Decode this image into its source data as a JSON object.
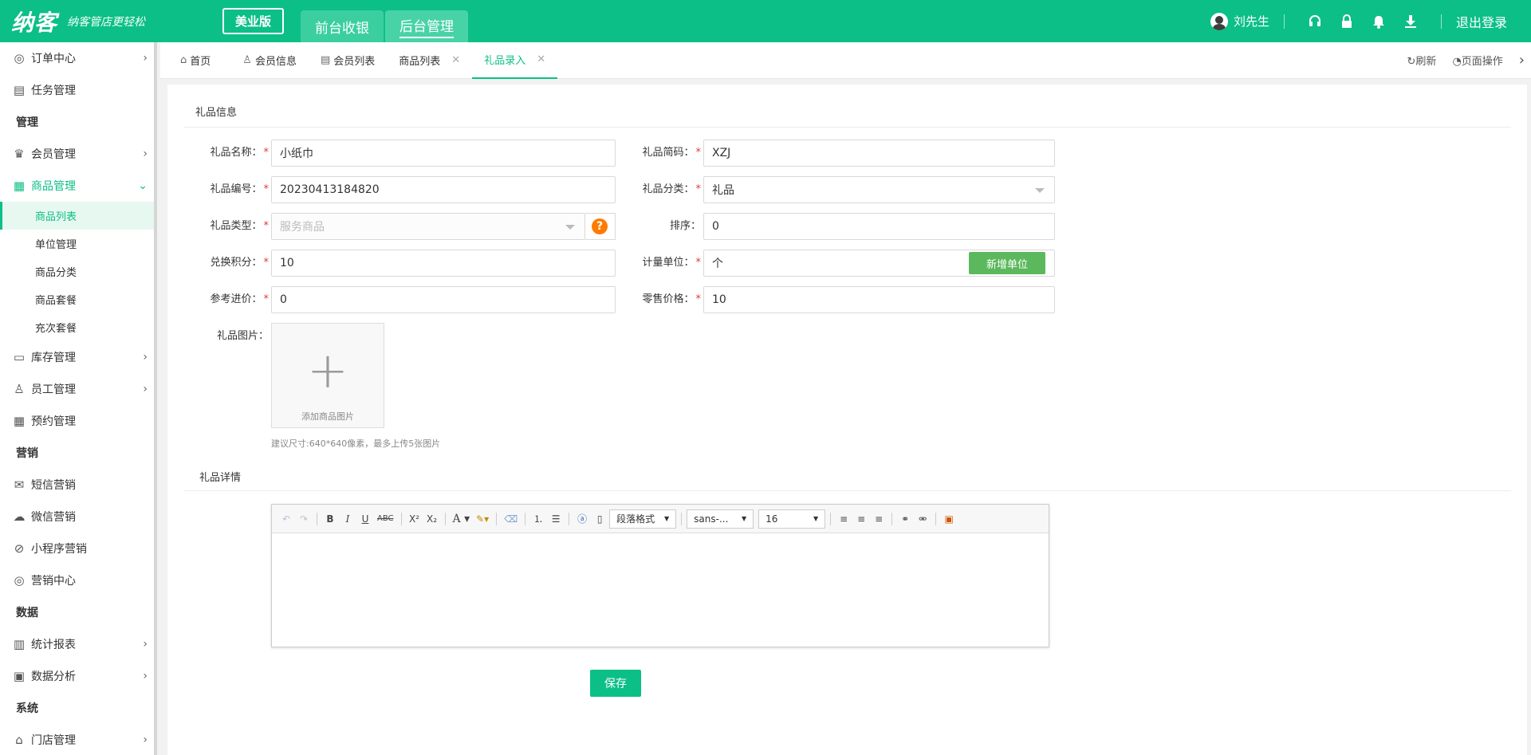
{
  "header": {
    "logo": "纳客",
    "slogan": "纳客管店更轻松",
    "edition": "美业版",
    "tabs": [
      {
        "label": "前台收银"
      },
      {
        "label": "后台管理"
      }
    ],
    "user_name": "刘先生",
    "logout": "退出登录",
    "icons": [
      "headset-icon",
      "lock-icon",
      "bell-icon",
      "download-icon"
    ]
  },
  "sidebar": {
    "items": [
      {
        "label": "订单中心"
      },
      {
        "label": "任务管理"
      },
      {
        "group": "管理"
      },
      {
        "label": "会员管理"
      },
      {
        "label": "商品管理"
      },
      {
        "sub": "商品列表"
      },
      {
        "sub": "单位管理"
      },
      {
        "sub": "商品分类"
      },
      {
        "sub": "商品套餐"
      },
      {
        "sub": "充次套餐"
      },
      {
        "label": "库存管理"
      },
      {
        "label": "员工管理"
      },
      {
        "label": "预约管理"
      },
      {
        "group": "营销"
      },
      {
        "label": "短信营销"
      },
      {
        "label": "微信营销"
      },
      {
        "label": "小程序营销"
      },
      {
        "label": "营销中心"
      },
      {
        "group": "数据"
      },
      {
        "label": "统计报表"
      },
      {
        "label": "数据分析"
      },
      {
        "group": "系统"
      },
      {
        "label": "门店管理"
      }
    ]
  },
  "page_tabs": {
    "tabs": [
      {
        "label": "首页"
      },
      {
        "label": "会员信息"
      },
      {
        "label": "会员列表"
      },
      {
        "label": "商品列表"
      },
      {
        "label": "礼品录入"
      }
    ],
    "refresh": "刷新",
    "page_ops": "页面操作"
  },
  "form": {
    "section_info": "礼品信息",
    "gift_name_label": "礼品名称：",
    "gift_name": "小纸巾",
    "gift_code_label": "礼品简码：",
    "gift_code": "XZJ",
    "gift_no_label": "礼品编号：",
    "gift_no": "20230413184820",
    "gift_category_label": "礼品分类：",
    "gift_category": "礼品",
    "gift_type_label": "礼品类型：",
    "gift_type_placeholder": "服务商品",
    "sort_label": "排序：",
    "sort": "0",
    "points_label": "兑换积分：",
    "points": "10",
    "unit_label": "计量单位：",
    "unit": "个",
    "add_unit": "新增单位",
    "ref_price_label": "参考进价：",
    "ref_price": "0",
    "retail_price_label": "零售价格：",
    "retail_price": "10",
    "image_label": "礼品图片：",
    "image_upload": "添加商品图片",
    "image_hint": "建议尺寸:640*640像素，最多上传5张图片",
    "section_detail": "礼品详情",
    "save": "保存"
  },
  "editor": {
    "paragraph_format": "段落格式",
    "font_family": "sans-...",
    "font_size": "16"
  }
}
